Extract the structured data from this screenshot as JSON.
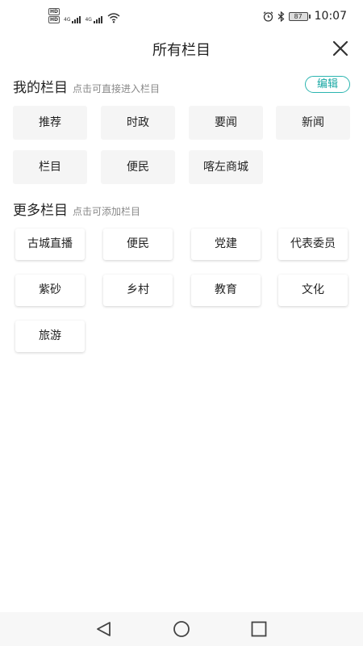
{
  "status_bar": {
    "hd_1": "HD",
    "hd_2": "HD",
    "net_1": "4G",
    "net_2": "4G",
    "battery": "87",
    "time": "10:07"
  },
  "header": {
    "title": "所有栏目"
  },
  "my_channels": {
    "title": "我的栏目",
    "hint": "点击可直接进入栏目",
    "edit_label": "编辑",
    "items": [
      "推荐",
      "时政",
      "要闻",
      "新闻",
      "栏目",
      "便民",
      "喀左商城"
    ]
  },
  "more_channels": {
    "title": "更多栏目",
    "hint": "点击可添加栏目",
    "items": [
      "古城直播",
      "便民",
      "党建",
      "代表委员",
      "紫砂",
      "乡村",
      "教育",
      "文化",
      "旅游"
    ]
  },
  "nav": {
    "icons": [
      "back-triangle-icon",
      "home-circle-icon",
      "recents-square-icon"
    ]
  }
}
